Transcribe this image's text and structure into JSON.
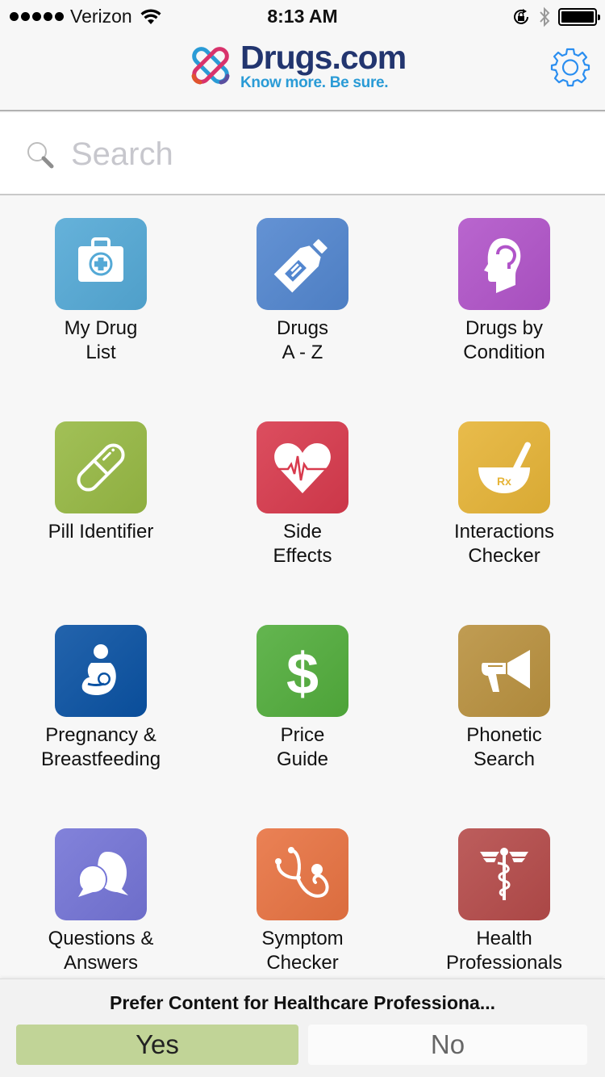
{
  "status_bar": {
    "carrier": "Verizon",
    "time": "8:13 AM",
    "signal_bars": 5,
    "battery_level": 1.0,
    "icons": [
      "signal-dots-icon",
      "wifi-icon",
      "rotation-lock-icon",
      "bluetooth-icon",
      "battery-icon"
    ]
  },
  "header": {
    "brand_name": "Drugs.com",
    "tagline": "Know more. Be sure.",
    "settings_icon": "gear-icon",
    "colors": {
      "brand_navy": "#22356f",
      "brand_blue": "#2a9bd6",
      "gear_blue": "#2a8ef0"
    }
  },
  "search": {
    "placeholder": "Search",
    "value": "",
    "icon": "search-icon"
  },
  "tiles": [
    {
      "id": "my-drug-list",
      "lines": [
        "My Drug",
        "List"
      ],
      "icon": "first-aid-kit-icon",
      "color": "#54a9d6"
    },
    {
      "id": "drugs-a-z",
      "lines": [
        "Drugs",
        "A - Z"
      ],
      "icon": "medicine-bottle-icon",
      "color": "#5286cf"
    },
    {
      "id": "drugs-by-condition",
      "lines": [
        "Drugs by",
        "Condition"
      ],
      "icon": "brain-head-icon",
      "color": "#b154c9"
    },
    {
      "id": "pill-identifier",
      "lines": [
        "Pill Identifier"
      ],
      "icon": "capsule-icon",
      "color": "#97b944"
    },
    {
      "id": "side-effects",
      "lines": [
        "Side",
        "Effects"
      ],
      "icon": "heart-pulse-icon",
      "color": "#d83a4d"
    },
    {
      "id": "interactions-checker",
      "lines": [
        "Interactions",
        "Checker"
      ],
      "icon": "mortar-pestle-icon",
      "color": "#e6b437"
    },
    {
      "id": "pregnancy-breastfeeding",
      "lines": [
        "Pregnancy &",
        "Breastfeeding"
      ],
      "icon": "breastfeeding-icon",
      "color": "#0a52a3"
    },
    {
      "id": "price-guide",
      "lines": [
        "Price",
        "Guide"
      ],
      "icon": "dollar-icon",
      "color": "#52ad3c"
    },
    {
      "id": "phonetic-search",
      "lines": [
        "Phonetic",
        "Search"
      ],
      "icon": "megaphone-icon",
      "color": "#b9913f"
    },
    {
      "id": "questions-answers",
      "lines": [
        "Questions &",
        "Answers"
      ],
      "icon": "chat-bubbles-icon",
      "color": "#7474d6"
    },
    {
      "id": "symptom-checker",
      "lines": [
        "Symptom",
        "Checker"
      ],
      "icon": "stethoscope-icon",
      "color": "#e87342"
    },
    {
      "id": "health-professionals",
      "lines": [
        "Health",
        "Professionals"
      ],
      "icon": "caduceus-icon",
      "color": "#b54b4a"
    }
  ],
  "prompt": {
    "text": "Prefer Content for Healthcare Professiona...",
    "yes_label": "Yes",
    "no_label": "No",
    "colors": {
      "yes_bg": "#c1d497",
      "no_bg": "#fbfbfb"
    }
  }
}
